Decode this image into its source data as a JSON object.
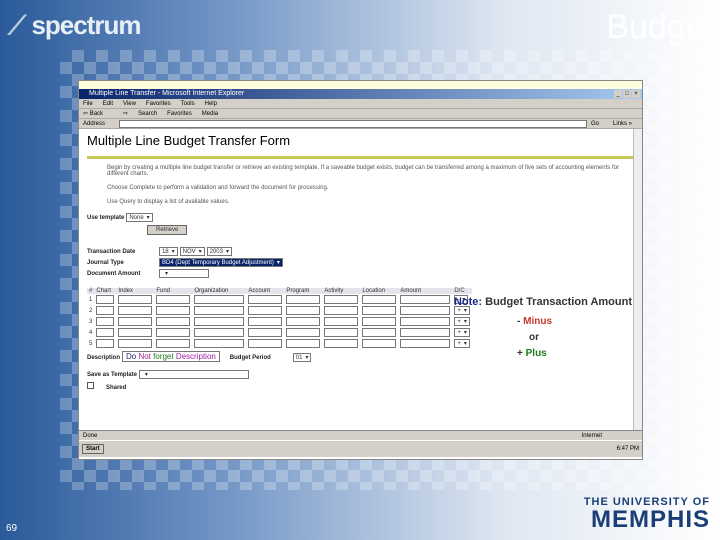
{
  "slide": {
    "logo": "spectrum",
    "title": "Budget",
    "page_number": "69",
    "university_line1": "THE UNIVERSITY OF",
    "university_line2": "MEMPHIS"
  },
  "browser": {
    "window_title": "Multiple Line Transfer - Microsoft Internet Explorer",
    "menu": [
      "File",
      "Edit",
      "View",
      "Favorites",
      "Tools",
      "Help"
    ],
    "toolbar": [
      "Back",
      "Search",
      "Favorites",
      "Media"
    ],
    "address_label": "Address",
    "go": "Go",
    "links": "Links »",
    "status": "Done",
    "zone": "Internet"
  },
  "form": {
    "title": "Multiple Line Budget Transfer Form",
    "intro": "Begin by creating a multiple line budget transfer or retrieve an existing template. If a saveable budget exists, budget can be transferred among a maximum of five sets of accounting elements for different charts.",
    "complete_text": "Choose Complete to perform a validation and forward the document for processing.",
    "query_text": "Use Query to display a list of available values.",
    "use_template_label": "Use template",
    "use_template_value": "None",
    "retrieve": "Retrieve",
    "transaction_date_label": "Transaction Date",
    "date_day": "18",
    "date_month": "NOV",
    "date_year": "2003",
    "journal_type_label": "Journal Type",
    "journal_type_value": "BD4 (Dept Temporary Budget Adjustment)",
    "document_amount_label": "Document Amount",
    "columns": [
      "#",
      "Chart",
      "Index",
      "Fund",
      "Organization",
      "Account",
      "Program",
      "Activity",
      "Location",
      "Amount",
      "D/C"
    ],
    "rows": [
      {
        "n": "1",
        "dc": "-"
      },
      {
        "n": "2",
        "dc": "+"
      },
      {
        "n": "3",
        "dc": "+"
      },
      {
        "n": "4",
        "dc": "+"
      },
      {
        "n": "5",
        "dc": "+"
      }
    ],
    "description_label": "Description",
    "description_do": "Do",
    "description_not": "Not",
    "description_forget": "forget",
    "description_word": "Description",
    "budget_period_label": "Budget Period",
    "budget_period_value": "01",
    "save_template_label": "Save as Template",
    "shared_label": "Shared"
  },
  "note": {
    "prefix": "Note:",
    "text": "Budget Transaction Amount",
    "minus_sign": "-",
    "minus": "Minus",
    "or": "or",
    "plus_sign": "+",
    "plus": "Plus",
    "minus_color": "#c0392b",
    "plus_color": "#1e7a1e"
  },
  "taskbar": {
    "start": "Start",
    "clock": "6:47 PM"
  }
}
